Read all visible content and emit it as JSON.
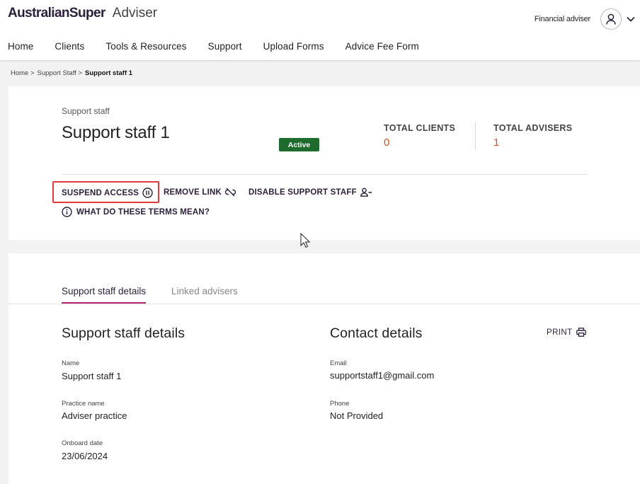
{
  "header": {
    "brand_name": "AustralianSuper",
    "brand_sub": "Adviser",
    "role": "Financial adviser",
    "nav": [
      "Home",
      "Clients",
      "Tools & Resources",
      "Support",
      "Upload Forms",
      "Advice Fee Form"
    ]
  },
  "breadcrumb": [
    "Home >",
    "Support Staff >",
    "Support staff 1"
  ],
  "profile": {
    "kicker": "Support staff",
    "title": "Support staff 1",
    "status": "Active",
    "stats": [
      {
        "label": "TOTAL CLIENTS",
        "value": "0"
      },
      {
        "label": "TOTAL ADVISERS",
        "value": "1"
      }
    ],
    "actions": {
      "suspend": "SUSPEND ACCESS",
      "remove": "REMOVE LINK",
      "disable": "DISABLE SUPPORT STAFF",
      "terms": "WHAT DO THESE TERMS MEAN?"
    }
  },
  "tabs": [
    "Support staff details",
    "Linked advisers"
  ],
  "details": {
    "title": "Support staff details",
    "fields": [
      {
        "label": "Name",
        "value": "Support staff 1"
      },
      {
        "label": "Practice name",
        "value": "Adviser practice"
      },
      {
        "label": "Onboard date",
        "value": "23/06/2024"
      }
    ]
  },
  "contact": {
    "title": "Contact details",
    "print_label": "PRINT",
    "fields": [
      {
        "label": "Email",
        "value": "supportstaff1@gmail.com"
      },
      {
        "label": "Phone",
        "value": "Not Provided"
      }
    ]
  },
  "colors": {
    "accent": "#b0276e",
    "brand_dark": "#2b1f3b",
    "status_green": "#1f6b2e",
    "stat_orange": "#d2521d",
    "highlight_red": "#e0393e"
  }
}
